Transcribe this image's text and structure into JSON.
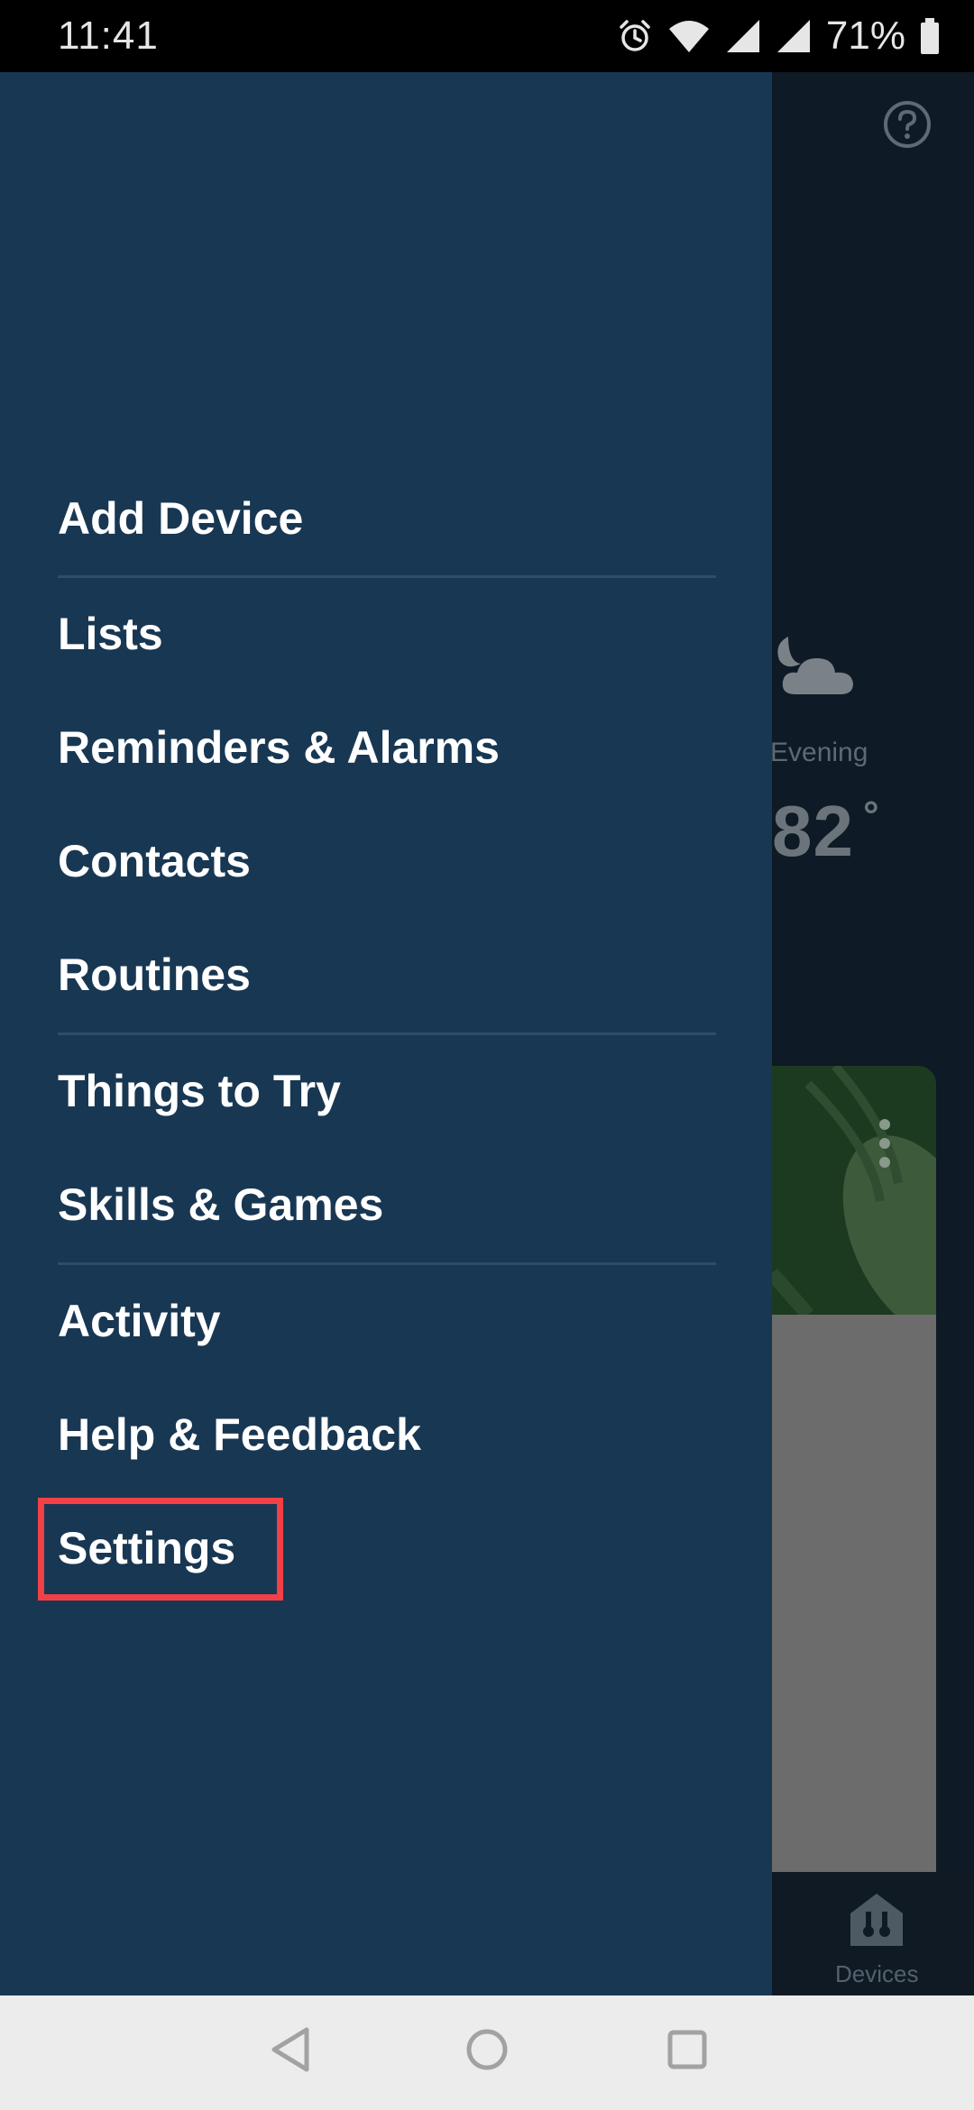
{
  "status_bar": {
    "time": "11:41",
    "battery": "71%",
    "icons": [
      "alarm-icon",
      "wifi-icon",
      "signal-icon",
      "signal-icon",
      "battery-icon"
    ]
  },
  "drawer": {
    "items": [
      {
        "label": "Add Device"
      },
      {
        "label": "Lists"
      },
      {
        "label": "Reminders & Alarms"
      },
      {
        "label": "Contacts"
      },
      {
        "label": "Routines"
      },
      {
        "label": "Things to Try"
      },
      {
        "label": "Skills & Games"
      },
      {
        "label": "Activity"
      },
      {
        "label": "Help & Feedback"
      },
      {
        "label": "Settings"
      }
    ],
    "highlighted_item": "Settings",
    "highlight_color": "#f14046",
    "background_color": "#183753"
  },
  "background_app": {
    "weather_label": "Evening",
    "weather_temp": "82",
    "weather_degree": "°",
    "bottom_nav_label": "Devices"
  },
  "nav_bar": {
    "buttons": [
      "back-icon",
      "home-icon",
      "recents-icon"
    ]
  }
}
